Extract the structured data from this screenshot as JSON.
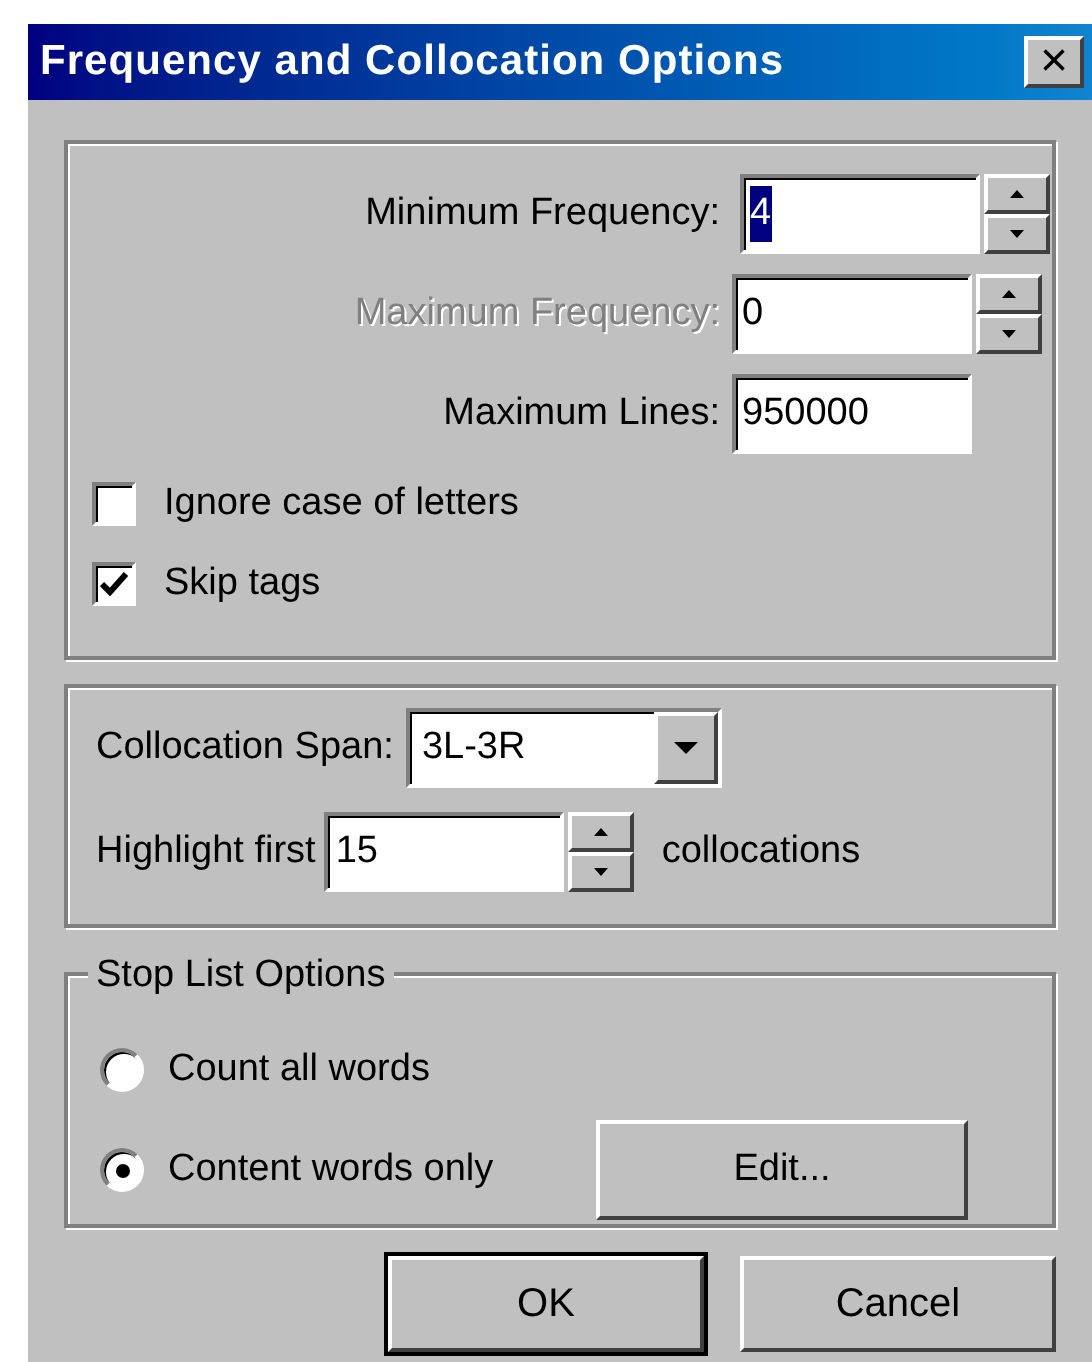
{
  "window": {
    "title": "Frequency and Collocation Options",
    "close": "×"
  },
  "frequency_group": {
    "fields": [
      {
        "label": "Minimum Frequency:",
        "value": "4",
        "disabled": false,
        "value_selected": true,
        "kind": "spin"
      },
      {
        "label": "Maximum Frequency:",
        "value": "0",
        "disabled": true,
        "value_selected": false,
        "kind": "spin"
      },
      {
        "label": "Maximum Lines:",
        "value": "950000",
        "disabled": false,
        "value_selected": false,
        "kind": "text"
      }
    ],
    "checkboxes": [
      {
        "label": "Ignore case of letters",
        "checked": false
      },
      {
        "label": "Skip tags",
        "checked": true
      }
    ]
  },
  "collocation_group": {
    "span_label": "Collocation Span:",
    "span_value": "3L-3R",
    "highlight_label": "Highlight first",
    "highlight_value": "15",
    "highlight_suffix": "collocations"
  },
  "stop_list_group": {
    "legend": "Stop List Options",
    "radios": [
      {
        "label": "Count all words",
        "selected": false
      },
      {
        "label": "Content words only",
        "selected": true
      }
    ],
    "edit_button": "Edit..."
  },
  "buttons": [
    {
      "label": "OK",
      "default": true
    },
    {
      "label": "Cancel",
      "default": false
    }
  ]
}
